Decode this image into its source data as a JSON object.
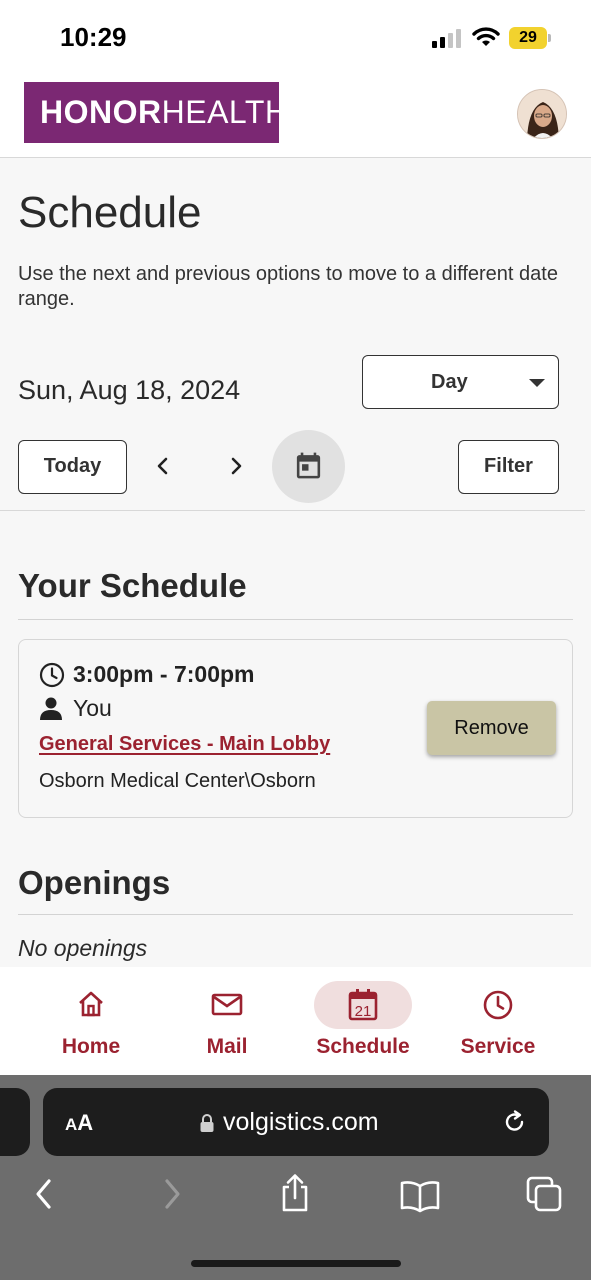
{
  "status_bar": {
    "time": "10:29",
    "battery": "29",
    "signal_icon": "cellular-signal-icon",
    "wifi_icon": "wifi-icon"
  },
  "header": {
    "logo_part1": "HONOR",
    "logo_part2": "HEALTH",
    "logo_tm": "TM",
    "brand_color": "#7b2873"
  },
  "page": {
    "title": "Schedule",
    "instructions": "Use the next and previous options to move to a different date range.",
    "current_date": "Sun, Aug 18, 2024",
    "view_select_value": "Day",
    "today_label": "Today",
    "filter_label": "Filter"
  },
  "your_schedule": {
    "title": "Your Schedule",
    "shift": {
      "time": "3:00pm - 7:00pm",
      "assignee": "You",
      "assignment": "General Services - Main Lobby",
      "location": "Osborn Medical Center\\Osborn",
      "remove_label": "Remove"
    }
  },
  "openings": {
    "title": "Openings",
    "empty_text": "No openings"
  },
  "bottom_nav": {
    "items": [
      {
        "label": "Home",
        "icon": "home-icon"
      },
      {
        "label": "Mail",
        "icon": "mail-icon"
      },
      {
        "label": "Schedule",
        "icon": "calendar-icon",
        "badge": "21",
        "active": true
      },
      {
        "label": "Service",
        "icon": "clock-icon"
      }
    ],
    "accent_color": "#9b2230"
  },
  "browser": {
    "aa_label_small": "A",
    "aa_label_large": "A",
    "url": "volgistics.com"
  }
}
